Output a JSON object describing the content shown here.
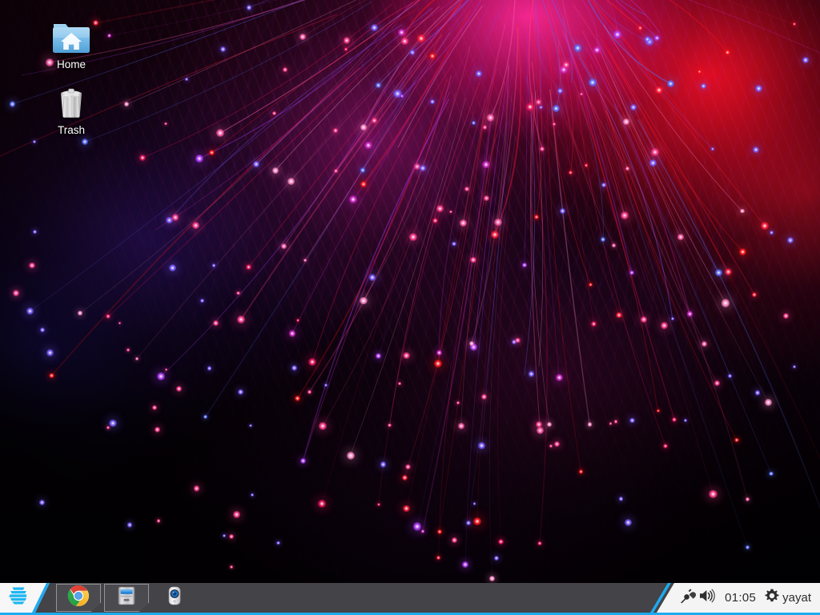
{
  "desktop": {
    "icons": [
      {
        "name": "home",
        "label": "Home",
        "icon": "home-folder-icon"
      },
      {
        "name": "trash",
        "label": "Trash",
        "icon": "trash-can-icon"
      }
    ],
    "wallpaper": {
      "description": "fiber optic strands burst",
      "colors": {
        "magenta": "#ff2896",
        "red": "#ff0f23",
        "purple": "#6a1ea8",
        "blue": "#2823b9",
        "background": "#0a0208"
      }
    }
  },
  "taskbar": {
    "accent_color": "#1eaaef",
    "background_color": "#48484e",
    "panel_background": "#f4f4f4",
    "start": {
      "label": "Zorin Menu",
      "icon": "zorin-logo-icon"
    },
    "launchers": [
      {
        "label": "Google Chrome",
        "icon": "chrome-icon"
      },
      {
        "label": "File Manager",
        "icon": "file-manager-icon"
      },
      {
        "label": "Cheese Webcam",
        "icon": "webcam-icon"
      }
    ],
    "tray": {
      "network": {
        "label": "Network Connection",
        "icon": "plug-icon"
      },
      "volume": {
        "label": "Volume",
        "icon": "speaker-icon"
      },
      "clock": "01:05",
      "settings": {
        "label": "Settings",
        "icon": "gear-icon"
      },
      "user": "yayat"
    }
  }
}
